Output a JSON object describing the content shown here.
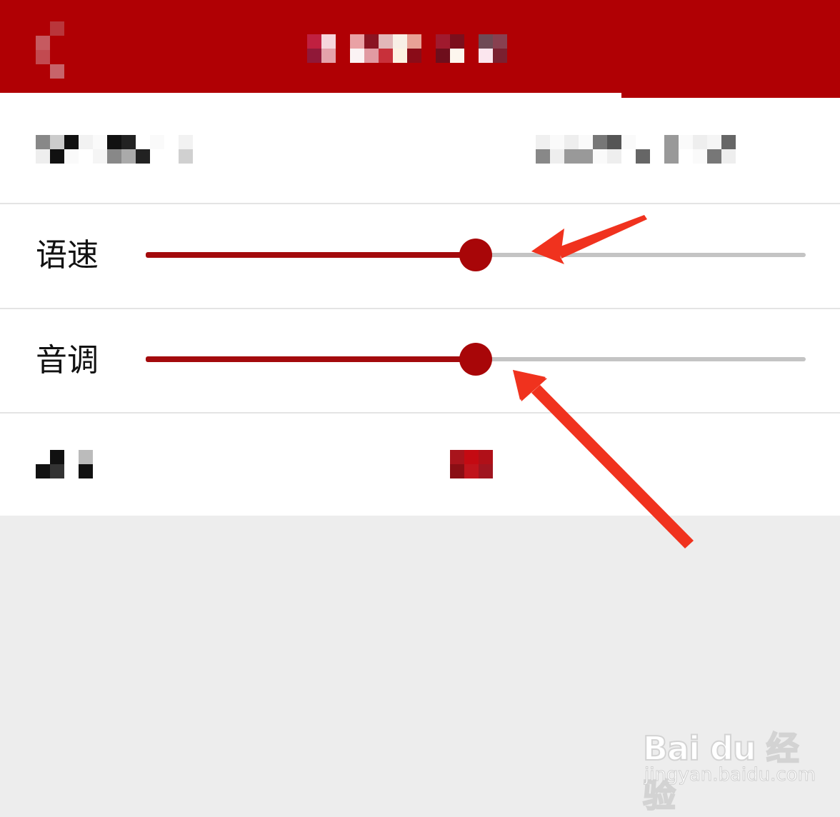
{
  "header": {
    "title": "",
    "back_icon": "back-icon"
  },
  "rows": {
    "speed": {
      "label": "语速",
      "value": 0.5
    },
    "pitch": {
      "label": "音调",
      "value": 0.5
    }
  },
  "colors": {
    "accent": "#a80608",
    "header": "#b00004",
    "track": "#c4c4c4",
    "annotation_arrow": "#f0321e"
  },
  "watermark": {
    "brand": "Bai du 经验",
    "url": "jingyan.baidu.com"
  }
}
